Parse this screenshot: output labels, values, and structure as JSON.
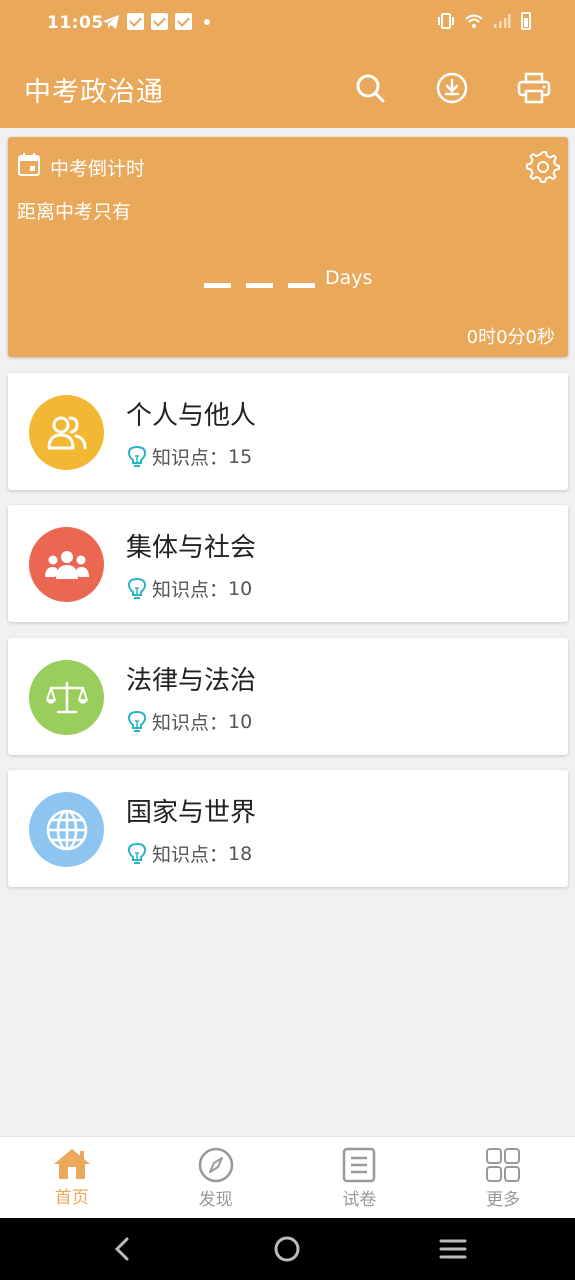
{
  "status": {
    "time": "11:05",
    "left_icons": [
      "telegram-icon",
      "notification-icon",
      "notification-icon",
      "notification-icon",
      "dot-icon"
    ],
    "right_icons": [
      "vibrate-icon",
      "wifi-icon",
      "signal-icon",
      "battery-icon"
    ]
  },
  "app_bar": {
    "title": "中考政治通",
    "actions": [
      "search-icon",
      "download-icon",
      "print-icon"
    ]
  },
  "countdown": {
    "title": "中考倒计时",
    "subtitle": "距离中考只有",
    "days_unit": "Days",
    "time_remaining": "0时0分0秒"
  },
  "cards": [
    {
      "title": "个人与他人",
      "meta_label": "知识点：",
      "count": "15",
      "icon": "people-icon",
      "color": "#f2b733"
    },
    {
      "title": "集体与社会",
      "meta_label": "知识点：",
      "count": "10",
      "icon": "group-icon",
      "color": "#ec6752"
    },
    {
      "title": "法律与法治",
      "meta_label": "知识点：",
      "count": "10",
      "icon": "scale-icon",
      "color": "#99cd5c"
    },
    {
      "title": "国家与世界",
      "meta_label": "知识点：",
      "count": "18",
      "icon": "globe-icon",
      "color": "#8ec5f0"
    }
  ],
  "bottom_nav": [
    {
      "label": "首页",
      "icon": "home-icon",
      "active": true
    },
    {
      "label": "发现",
      "icon": "compass-icon",
      "active": false
    },
    {
      "label": "试卷",
      "icon": "document-icon",
      "active": false
    },
    {
      "label": "更多",
      "icon": "grid-icon",
      "active": false
    }
  ],
  "colors": {
    "primary": "#e9a85a",
    "accent_bulb": "#2bb3c8",
    "inactive": "#999999"
  }
}
